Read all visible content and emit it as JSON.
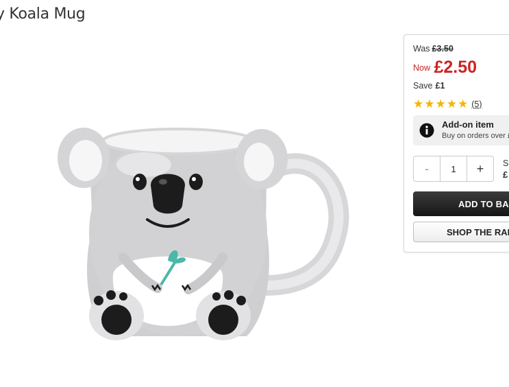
{
  "product": {
    "title": "y Koala Mug"
  },
  "price": {
    "was_label": "Was",
    "was_value": "£3.50",
    "now_label": "Now",
    "now_value": "£2.50",
    "save_label": "Save",
    "save_value": "£1"
  },
  "rating": {
    "stars": 5,
    "max_stars": 5,
    "review_count": "(5)"
  },
  "addon": {
    "title": "Add-on item",
    "subtitle": "Buy on orders over £",
    "icon": "info-icon"
  },
  "quantity": {
    "minus_label": "-",
    "value": "1",
    "plus_label": "+"
  },
  "subtotal": {
    "label": "Su",
    "value": "£"
  },
  "buttons": {
    "add_to_bag": "ADD TO BAG",
    "shop_range": "SHOP THE RAN"
  },
  "colors": {
    "sale_red": "#cc2424",
    "star_gold": "#f2b600",
    "button_dark": "#1f1f1f"
  }
}
